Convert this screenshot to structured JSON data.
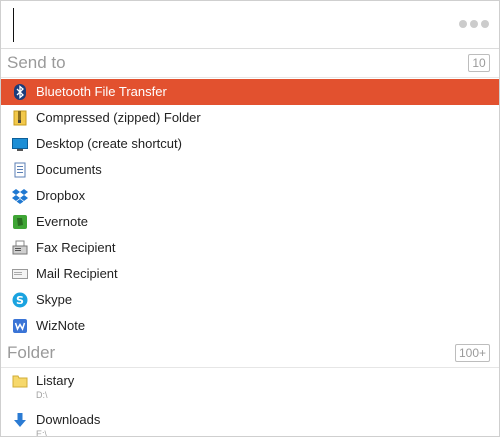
{
  "search": {
    "placeholder": ""
  },
  "send_to": {
    "title": "Send to",
    "count": "10",
    "items": [
      {
        "label": "Bluetooth File Transfer",
        "icon": "bluetooth-icon",
        "selected": true
      },
      {
        "label": "Compressed (zipped) Folder",
        "icon": "zip-folder-icon"
      },
      {
        "label": "Desktop (create shortcut)",
        "icon": "desktop-icon"
      },
      {
        "label": "Documents",
        "icon": "documents-icon"
      },
      {
        "label": "Dropbox",
        "icon": "dropbox-icon"
      },
      {
        "label": "Evernote",
        "icon": "evernote-icon"
      },
      {
        "label": "Fax Recipient",
        "icon": "fax-icon"
      },
      {
        "label": "Mail Recipient",
        "icon": "mail-icon"
      },
      {
        "label": "Skype",
        "icon": "skype-icon"
      },
      {
        "label": "WizNote",
        "icon": "wiznote-icon"
      }
    ]
  },
  "folder": {
    "title": "Folder",
    "count": "100+",
    "items": [
      {
        "label": "Listary",
        "path": "D:\\",
        "icon": "folder-icon"
      },
      {
        "label": "Downloads",
        "path": "E:\\",
        "icon": "download-arrow-icon"
      }
    ]
  },
  "colors": {
    "selected_bg": "#e2512f",
    "section_text": "#9a9a9a"
  }
}
